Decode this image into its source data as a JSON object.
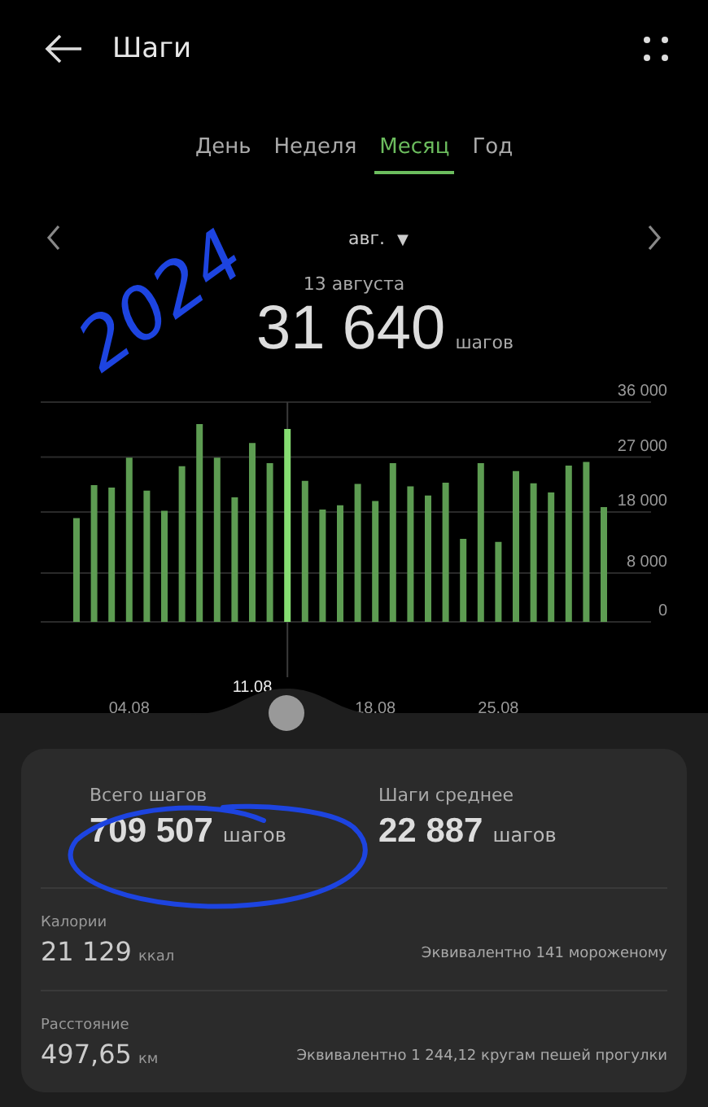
{
  "header": {
    "title": "Шаги"
  },
  "tabs": [
    {
      "label": "День",
      "selected": false
    },
    {
      "label": "Неделя",
      "selected": false
    },
    {
      "label": "Месяц",
      "selected": true
    },
    {
      "label": "Год",
      "selected": false
    }
  ],
  "period": {
    "label": "авг.",
    "dropdown": "▼"
  },
  "selection": {
    "date": "13 августа",
    "value": "31 640",
    "unit": "шагов"
  },
  "chart": {
    "week_label": "11.08",
    "bars": [
      {
        "selected": false
      },
      {
        "selected": false
      },
      {
        "selected": false
      },
      {
        "selected": false
      },
      {
        "selected": false
      },
      {
        "selected": false
      },
      {
        "selected": false
      },
      {
        "selected": false
      },
      {
        "selected": false
      },
      {
        "selected": false
      },
      {
        "selected": false
      },
      {
        "selected": false
      },
      {
        "selected": true
      },
      {
        "selected": false
      },
      {
        "selected": false
      },
      {
        "selected": false
      },
      {
        "selected": false
      },
      {
        "selected": false
      },
      {
        "selected": false
      },
      {
        "selected": false
      },
      {
        "selected": false
      },
      {
        "selected": false
      },
      {
        "selected": false
      },
      {
        "selected": false
      },
      {
        "selected": false
      },
      {
        "selected": false
      },
      {
        "selected": false
      },
      {
        "selected": false
      },
      {
        "selected": false
      },
      {
        "selected": false
      },
      {
        "selected": false
      }
    ],
    "chart_data": {
      "type": "bar",
      "categories": [
        null,
        null,
        null,
        "04.08",
        null,
        null,
        null,
        null,
        null,
        null,
        null,
        null,
        null,
        null,
        null,
        null,
        null,
        "18.08",
        null,
        null,
        null,
        null,
        null,
        null,
        "25.08",
        null,
        null,
        null,
        null,
        null,
        null
      ],
      "values": [
        17000,
        22400,
        22000,
        26900,
        21500,
        18200,
        25500,
        32400,
        26900,
        20400,
        29300,
        26000,
        31600,
        23100,
        18400,
        19100,
        22600,
        19800,
        26000,
        22200,
        20700,
        22800,
        13600,
        26000,
        13100,
        24700,
        22700,
        21200,
        25600,
        26200,
        18800
      ],
      "grid": true,
      "ylim": [
        0,
        36000
      ],
      "yticks": [
        {
          "value": 0,
          "label": "0"
        },
        {
          "value": 8000,
          "label": "8 000"
        },
        {
          "value": 18000,
          "label": "18 000"
        },
        {
          "value": 27000,
          "label": "27 000"
        },
        {
          "value": 36000,
          "label": "36 000"
        }
      ]
    }
  },
  "summary": {
    "stats": [
      {
        "label": "Всего шагов",
        "value": "709 507",
        "unit": "шагов"
      },
      {
        "label": "Шаги среднее",
        "value": "22 887",
        "unit": "шагов"
      }
    ],
    "rows": [
      {
        "label": "Калории",
        "value": "21 129",
        "unit": "ккал",
        "note": "Эквивалентно 141 мороженому"
      },
      {
        "label": "Расстояние",
        "value": "497,65",
        "unit": "км",
        "note": "Эквивалентно 1 244,12 кругам пешей прогулки"
      }
    ]
  },
  "annotations": [
    {
      "kind": "handwriting",
      "text": "2024"
    },
    {
      "kind": "circle"
    }
  ]
}
